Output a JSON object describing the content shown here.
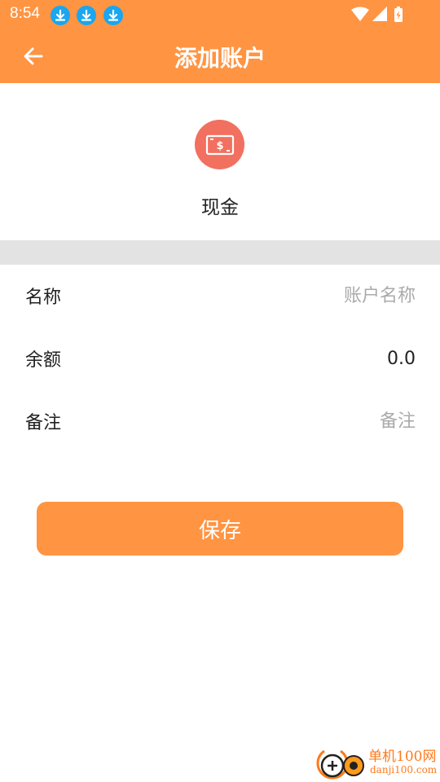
{
  "status_bar": {
    "time": "8:54",
    "notification_icons": [
      "download-icon",
      "download-icon",
      "download-icon"
    ],
    "right_icons": [
      "wifi-icon",
      "signal-icon",
      "battery-charging-icon"
    ]
  },
  "header": {
    "back_icon": "arrow-left-icon",
    "title": "添加账户"
  },
  "account_type": {
    "icon": "cash-icon",
    "label": "现金"
  },
  "form": {
    "name": {
      "label": "名称",
      "value": "",
      "placeholder": "账户名称"
    },
    "balance": {
      "label": "余额",
      "value": "0.0",
      "placeholder": ""
    },
    "note": {
      "label": "备注",
      "value": "",
      "placeholder": "备注"
    }
  },
  "save_button": {
    "label": "保存"
  },
  "watermark": {
    "line1": "单机100网",
    "line2": "danji100.com"
  },
  "colors": {
    "brand": "#ff9442",
    "icon_bg": "#f2705f",
    "divider": "#e3e3e3",
    "download_icon": "#1aa6f0",
    "placeholder": "#aaaaaa"
  }
}
